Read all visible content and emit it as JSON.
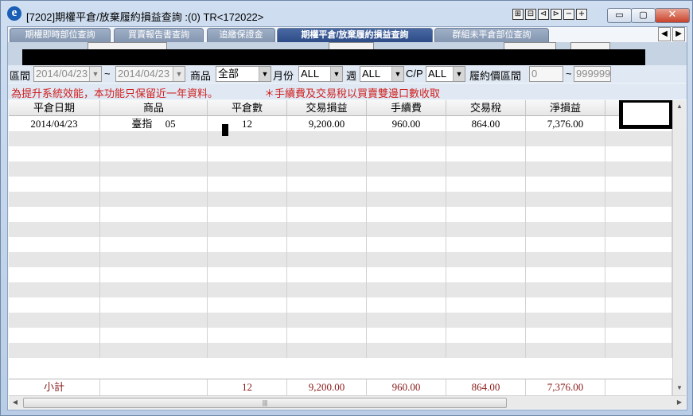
{
  "window": {
    "title": "[7202]期權平倉/放棄履約損益查詢 :(0) TR<172022>",
    "app_icon_glyph": "e",
    "mini_buttons": [
      "⊞",
      "⊟",
      "⊲",
      "⊳",
      "−",
      "+"
    ],
    "sys_buttons": {
      "minimize": "▭",
      "restore": "▢",
      "close": "✕"
    }
  },
  "tabs": [
    {
      "label": "期權即時部位查詢",
      "active": false
    },
    {
      "label": "買賣報告書查詢",
      "active": false
    },
    {
      "label": "追繳保證金",
      "active": false
    },
    {
      "label": "期權平倉/放棄履約損益查詢",
      "active": true
    },
    {
      "label": "群組未平倉部位查詢",
      "active": false
    }
  ],
  "tab_nav": {
    "prev": "◀",
    "next": "▶"
  },
  "filters": {
    "period_label": "區間",
    "date_from": "2014/04/23",
    "date_sep": "~",
    "date_to": "2014/04/23",
    "product_label": "商品",
    "product_value": "全部",
    "month_label": "月份",
    "month_value": "ALL",
    "week_label": "週",
    "week_value": "ALL",
    "cp_label": "C/P",
    "cp_value": "ALL",
    "strike_label": "履約價區間",
    "strike_from": "0",
    "strike_sep": "~",
    "strike_to": "999999"
  },
  "notices": {
    "left": "為提升系統效能，本功能只保留近一年資料。",
    "right": "＊手續費及交易稅以買賣雙邊口數收取"
  },
  "table": {
    "headers": [
      "平倉日期",
      "商品",
      "平倉數",
      "交易損益",
      "手續費",
      "交易稅",
      "淨損益"
    ],
    "rows": [
      [
        "2014/04/23",
        "臺指　 05",
        "12",
        "9,200.00",
        "960.00",
        "864.00",
        "7,376.00"
      ]
    ],
    "empty_rows": 15,
    "subtotal": [
      "小計",
      "",
      "12",
      "9,200.00",
      "960.00",
      "864.00",
      "7,376.00"
    ]
  },
  "scroll": {
    "up": "▲",
    "down": "▼",
    "left": "◀",
    "right": "▶",
    "grip": "|||"
  }
}
